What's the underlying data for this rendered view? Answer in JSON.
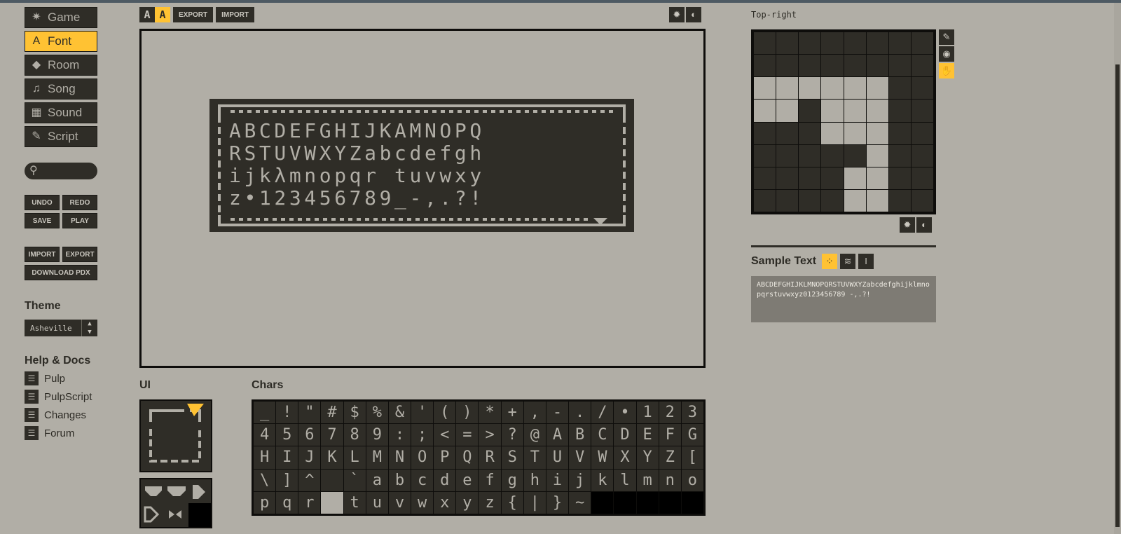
{
  "nav": {
    "items": [
      {
        "label": "Game",
        "icon": "star-burst-icon",
        "glyph": "✷",
        "active": false
      },
      {
        "label": "Font",
        "icon": "font-icon",
        "glyph": "A",
        "active": true
      },
      {
        "label": "Room",
        "icon": "diamond-icon",
        "glyph": "◆",
        "active": false
      },
      {
        "label": "Song",
        "icon": "music-note-icon",
        "glyph": "♫",
        "active": false
      },
      {
        "label": "Sound",
        "icon": "noise-icon",
        "glyph": "▦",
        "active": false
      },
      {
        "label": "Script",
        "icon": "scroll-icon",
        "glyph": "✎",
        "active": false
      }
    ]
  },
  "search": {
    "placeholder": ""
  },
  "actions": {
    "undo": "UNDO",
    "redo": "REDO",
    "save": "SAVE",
    "play": "PLAY"
  },
  "io": {
    "import": "IMPORT",
    "export": "EXPORT",
    "download": "DOWNLOAD PDX"
  },
  "theme": {
    "heading": "Theme",
    "value": "Asheville"
  },
  "help": {
    "heading": "Help & Docs",
    "links": [
      "Pulp",
      "PulpScript",
      "Changes",
      "Forum"
    ]
  },
  "toolbar": {
    "aa_small": "A",
    "aa_large": "A",
    "export": "EXPORT",
    "import": "IMPORT"
  },
  "preview": {
    "rows": [
      "ABCDEFGHIJKAMNOPQ",
      "RSTUVWXYZabcdefgh",
      "ijkλmnopqr tuvwxy",
      "z•123456789_-,.?!"
    ]
  },
  "sections": {
    "ui": "UI",
    "chars": "Chars"
  },
  "chars": [
    "_",
    "!",
    "\"",
    "#",
    "$",
    "%",
    "&",
    "'",
    "(",
    ")",
    "*",
    "+",
    ",",
    "-",
    ".",
    "/",
    "•",
    "1",
    "2",
    "3",
    "4",
    "5",
    "6",
    "7",
    "8",
    "9",
    ":",
    ";",
    "<",
    "=",
    ">",
    "?",
    "@",
    "A",
    "B",
    "C",
    "D",
    "E",
    "F",
    "G",
    "H",
    "I",
    "J",
    "K",
    "L",
    "M",
    "N",
    "O",
    "P",
    "Q",
    "R",
    "S",
    "T",
    "U",
    "V",
    "W",
    "X",
    "Y",
    "Z",
    "[",
    "\\",
    "]",
    "^",
    "",
    "`",
    "a",
    "b",
    "c",
    "d",
    "e",
    "f",
    "g",
    "h",
    "i",
    "j",
    "k",
    "l",
    "m",
    "n",
    "o",
    "p",
    "q",
    "r",
    "",
    "t",
    "u",
    "v",
    "w",
    "x",
    "y",
    "z",
    "{",
    "|",
    "}",
    "~",
    "",
    "",
    "",
    "",
    ""
  ],
  "tile_editor": {
    "label": "Top-right",
    "pixels": [
      [
        0,
        0,
        0,
        0,
        0,
        0,
        0,
        0
      ],
      [
        0,
        0,
        0,
        0,
        0,
        0,
        0,
        0
      ],
      [
        1,
        1,
        1,
        1,
        1,
        1,
        0,
        0
      ],
      [
        1,
        1,
        0,
        1,
        1,
        1,
        0,
        0
      ],
      [
        0,
        0,
        0,
        1,
        1,
        1,
        0,
        0
      ],
      [
        0,
        0,
        0,
        0,
        0,
        1,
        0,
        0
      ],
      [
        0,
        0,
        0,
        0,
        1,
        1,
        0,
        0
      ],
      [
        0,
        0,
        0,
        0,
        1,
        1,
        0,
        0
      ]
    ]
  },
  "sample": {
    "title": "Sample Text",
    "text": "ABCDEFGHIJKLMNOPQRSTUVWXYZabcdefghijklmnopqrstuvwxyz0123456789 -,.?!"
  },
  "colors": {
    "accent": "#ffc233",
    "dark": "#2f2d27",
    "light": "#b1aea6"
  }
}
